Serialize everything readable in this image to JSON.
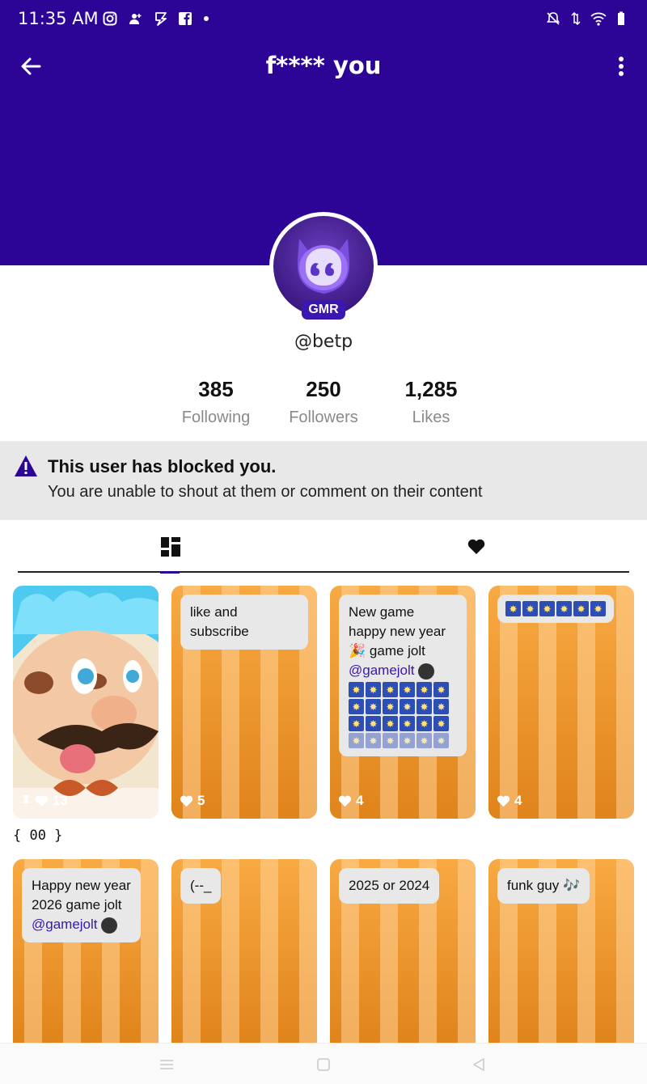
{
  "status_bar": {
    "time": "11:35 AM"
  },
  "header": {
    "title": "f**** you",
    "background": "#2c0596"
  },
  "profile": {
    "username": "@betp",
    "badge": "GMR",
    "stats": [
      {
        "value": "385",
        "label": "Following"
      },
      {
        "value": "250",
        "label": "Followers"
      },
      {
        "value": "1,285",
        "label": "Likes"
      }
    ]
  },
  "notice": {
    "title": "This user has blocked you.",
    "message": "You are unable to shout at them or comment on their content",
    "icon": "warning-icon"
  },
  "tabs": [
    {
      "icon": "dashboard-icon",
      "selected": true
    },
    {
      "icon": "heart-icon",
      "selected": false
    }
  ],
  "posts": [
    {
      "text": "",
      "likes": "13",
      "pinned": true,
      "caption": "{ 00  }"
    },
    {
      "text": "like and subscribe",
      "likes": "5"
    },
    {
      "text_lines": [
        "New game",
        "happy new year",
        "game jolt"
      ],
      "mention": "@gamejolt",
      "likes": "4"
    },
    {
      "text": "",
      "likes": "4"
    },
    {
      "text_lines": [
        "Happy new year",
        "2026 game jolt"
      ],
      "mention": "@gamejolt"
    },
    {
      "text": "(--_"
    },
    {
      "text": "2025 or 2024"
    },
    {
      "text": "funk guy 🎶"
    }
  ],
  "colors": {
    "accent": "#2c0596",
    "post_orange": "#f79a24",
    "mention": "#3a17b0"
  }
}
